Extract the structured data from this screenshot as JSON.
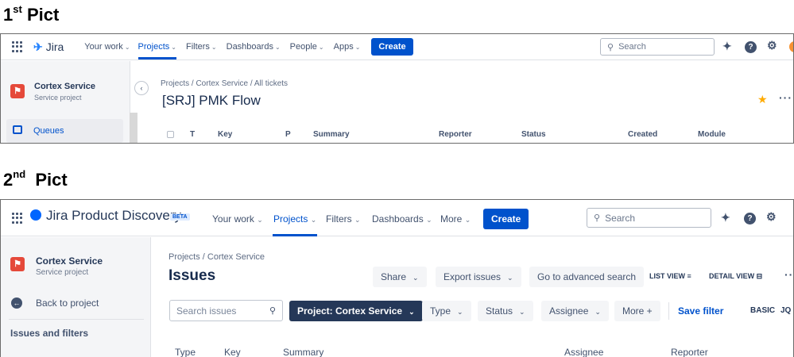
{
  "headings": {
    "first": {
      "num": "1",
      "sup": "st",
      "text": "Pict"
    },
    "second": {
      "num": "2",
      "sup": "nd",
      "text": "Pict"
    }
  },
  "shot1": {
    "app": {
      "logo_mark": "✈",
      "logo_text": "Jira"
    },
    "nav": [
      {
        "label": "Your work",
        "active": false
      },
      {
        "label": "Projects",
        "active": true
      },
      {
        "label": "Filters",
        "active": false
      },
      {
        "label": "Dashboards",
        "active": false
      },
      {
        "label": "People",
        "active": false
      },
      {
        "label": "Apps",
        "active": false
      }
    ],
    "create_label": "Create",
    "search_placeholder": "Search",
    "project": {
      "name": "Cortex Service",
      "type": "Service project"
    },
    "sidebar": {
      "queues_label": "Queues"
    },
    "breadcrumbs": "Projects  /  Cortex Service  /  All tickets",
    "page_title": "[SRJ] PMK Flow",
    "columns": [
      "T",
      "Key",
      "P",
      "Summary",
      "Reporter",
      "Status",
      "Created",
      "Module"
    ],
    "icons": [
      "grid-icon",
      "jira-logo-icon",
      "search-icon",
      "notification-icon",
      "help-icon",
      "settings-icon",
      "avatar",
      "collapse-icon",
      "queues-icon",
      "star-icon",
      "more-icon"
    ]
  },
  "shot2": {
    "app": {
      "logo_text": "Jira Product Discovery",
      "beta": "BETA"
    },
    "nav": [
      {
        "label": "Your work",
        "active": false
      },
      {
        "label": "Projects",
        "active": true
      },
      {
        "label": "Filters",
        "active": false
      },
      {
        "label": "Dashboards",
        "active": false
      },
      {
        "label": "More",
        "active": false
      }
    ],
    "create_label": "Create",
    "search_placeholder": "Search",
    "project": {
      "name": "Cortex Service",
      "type": "Service project"
    },
    "sidebar": {
      "back_label": "Back to project",
      "section_label": "Issues and filters"
    },
    "breadcrumbs": "Projects  /  Cortex Service",
    "page_title": "Issues",
    "actions": {
      "share": "Share",
      "export": "Export issues",
      "advanced": "Go to advanced search",
      "list_view": "LIST VIEW ≡",
      "detail_view": "DETAIL VIEW ⊟"
    },
    "filters": {
      "search_placeholder": "Search issues",
      "project_filter": "Project: Cortex Service",
      "type": "Type",
      "status": "Status",
      "assignee": "Assignee",
      "more": "More +",
      "save_filter": "Save filter",
      "basic": "BASIC",
      "jql": "JQ"
    },
    "columns": [
      "Type",
      "Key",
      "Summary",
      "Assignee",
      "Reporter"
    ],
    "accent": "#0052cc",
    "icons": [
      "grid-icon",
      "jpd-logo-icon",
      "search-icon",
      "notification-icon",
      "help-icon",
      "settings-icon",
      "back-icon",
      "magnifier-icon",
      "chevron-down-icon"
    ]
  }
}
